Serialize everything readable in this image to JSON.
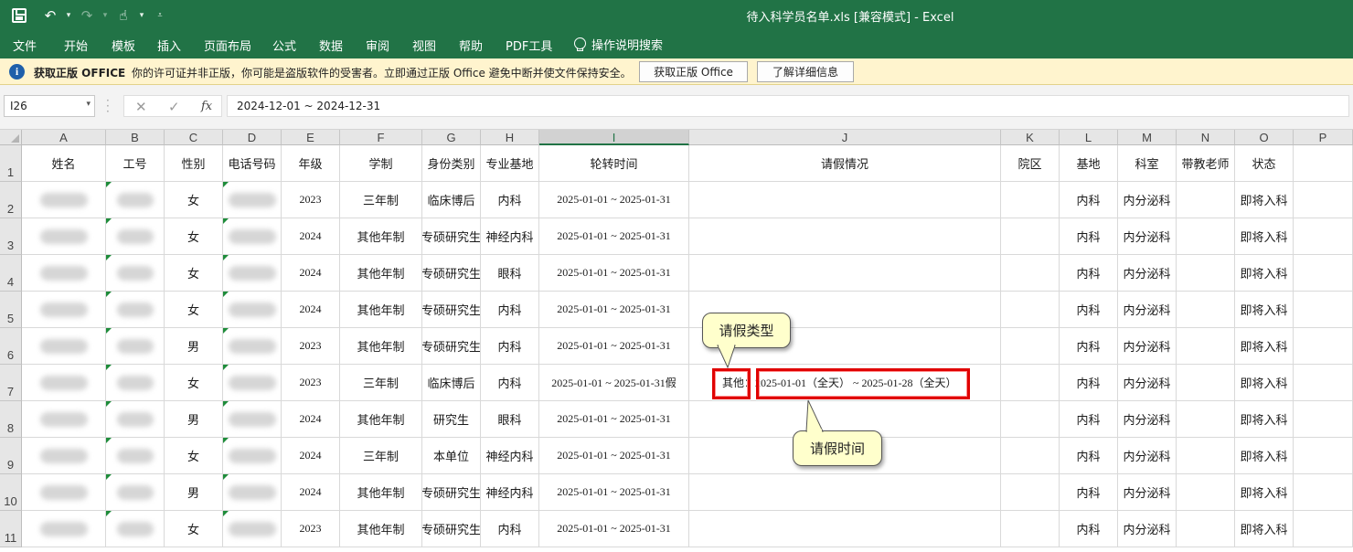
{
  "titlebar": {
    "title": "待入科学员名单.xls  [兼容模式]  -  Excel"
  },
  "ribbon": {
    "tabs": [
      "文件",
      "开始",
      "模板",
      "插入",
      "页面布局",
      "公式",
      "数据",
      "审阅",
      "视图",
      "帮助",
      "PDF工具"
    ],
    "tell_me": "操作说明搜索"
  },
  "message_bar": {
    "title": "获取正版 OFFICE",
    "text": "你的许可证并非正版，你可能是盗版软件的受害者。立即通过正版 Office 避免中断并使文件保持安全。",
    "button_genuine": "获取正版 Office",
    "button_learn": "了解详细信息"
  },
  "formula_bar": {
    "name_box": "I26",
    "content": "2024-12-01 ~ 2024-12-31"
  },
  "sheet": {
    "columns": [
      "A",
      "B",
      "C",
      "D",
      "E",
      "F",
      "G",
      "H",
      "I",
      "J",
      "K",
      "L",
      "M",
      "N",
      "O",
      "P"
    ],
    "selected_column": "I",
    "row_numbers": [
      "1",
      "2",
      "3",
      "4",
      "5",
      "6",
      "7",
      "8",
      "9",
      "10",
      "11"
    ],
    "headers": [
      "姓名",
      "工号",
      "性别",
      "电话号码",
      "年级",
      "学制",
      "身份类别",
      "专业基地",
      "轮转时间",
      "请假情况",
      "院区",
      "基地",
      "科室",
      "带教老师",
      "状态",
      ""
    ],
    "rows": [
      {
        "gender": "女",
        "grade": "2023",
        "system": "三年制",
        "identity": "临床博后",
        "base": "内科",
        "rotation": "2025-01-01 ~ 2025-01-31",
        "leave": "",
        "jidi": "内科",
        "dept": "内分泌科",
        "status": "即将入科"
      },
      {
        "gender": "女",
        "grade": "2024",
        "system": "其他年制",
        "identity": "专硕研究生",
        "base": "神经内科",
        "rotation": "2025-01-01 ~ 2025-01-31",
        "leave": "",
        "jidi": "内科",
        "dept": "内分泌科",
        "status": "即将入科"
      },
      {
        "gender": "女",
        "grade": "2024",
        "system": "其他年制",
        "identity": "专硕研究生",
        "base": "眼科",
        "rotation": "2025-01-01 ~ 2025-01-31",
        "leave": "",
        "jidi": "内科",
        "dept": "内分泌科",
        "status": "即将入科"
      },
      {
        "gender": "女",
        "grade": "2024",
        "system": "其他年制",
        "identity": "专硕研究生",
        "base": "内科",
        "rotation": "2025-01-01 ~ 2025-01-31",
        "leave": "",
        "jidi": "内科",
        "dept": "内分泌科",
        "status": "即将入科"
      },
      {
        "gender": "男",
        "grade": "2023",
        "system": "其他年制",
        "identity": "专硕研究生",
        "base": "内科",
        "rotation": "2025-01-01 ~ 2025-01-31",
        "leave": "",
        "jidi": "内科",
        "dept": "内分泌科",
        "status": "即将入科"
      },
      {
        "gender": "女",
        "grade": "2023",
        "system": "三年制",
        "identity": "临床博后",
        "base": "内科",
        "rotation": "2025-01-01 ~ 2025-01-31假",
        "leave": "其他：2025-01-01（全天） ~ 2025-01-28（全天）",
        "jidi": "内科",
        "dept": "内分泌科",
        "status": "即将入科"
      },
      {
        "gender": "男",
        "grade": "2024",
        "system": "其他年制",
        "identity": "研究生",
        "base": "眼科",
        "rotation": "2025-01-01 ~ 2025-01-31",
        "leave": "",
        "jidi": "内科",
        "dept": "内分泌科",
        "status": "即将入科"
      },
      {
        "gender": "女",
        "grade": "2024",
        "system": "三年制",
        "identity": "本单位",
        "base": "神经内科",
        "rotation": "2025-01-01 ~ 2025-01-31",
        "leave": "",
        "jidi": "内科",
        "dept": "内分泌科",
        "status": "即将入科"
      },
      {
        "gender": "男",
        "grade": "2024",
        "system": "其他年制",
        "identity": "专硕研究生",
        "base": "神经内科",
        "rotation": "2025-01-01 ~ 2025-01-31",
        "leave": "",
        "jidi": "内科",
        "dept": "内分泌科",
        "status": "即将入科"
      },
      {
        "gender": "女",
        "grade": "2023",
        "system": "其他年制",
        "identity": "专硕研究生",
        "base": "内科",
        "rotation": "2025-01-01 ~ 2025-01-31",
        "leave": "",
        "jidi": "内科",
        "dept": "内分泌科",
        "status": "即将入科"
      }
    ]
  },
  "annotations": {
    "leave_type": "请假类型",
    "leave_time": "请假时间"
  },
  "colors": {
    "excel_green": "#217346",
    "highlight_red": "#e00000",
    "callout_fill": "#ffffcc",
    "message_bar": "#fff4ce"
  }
}
